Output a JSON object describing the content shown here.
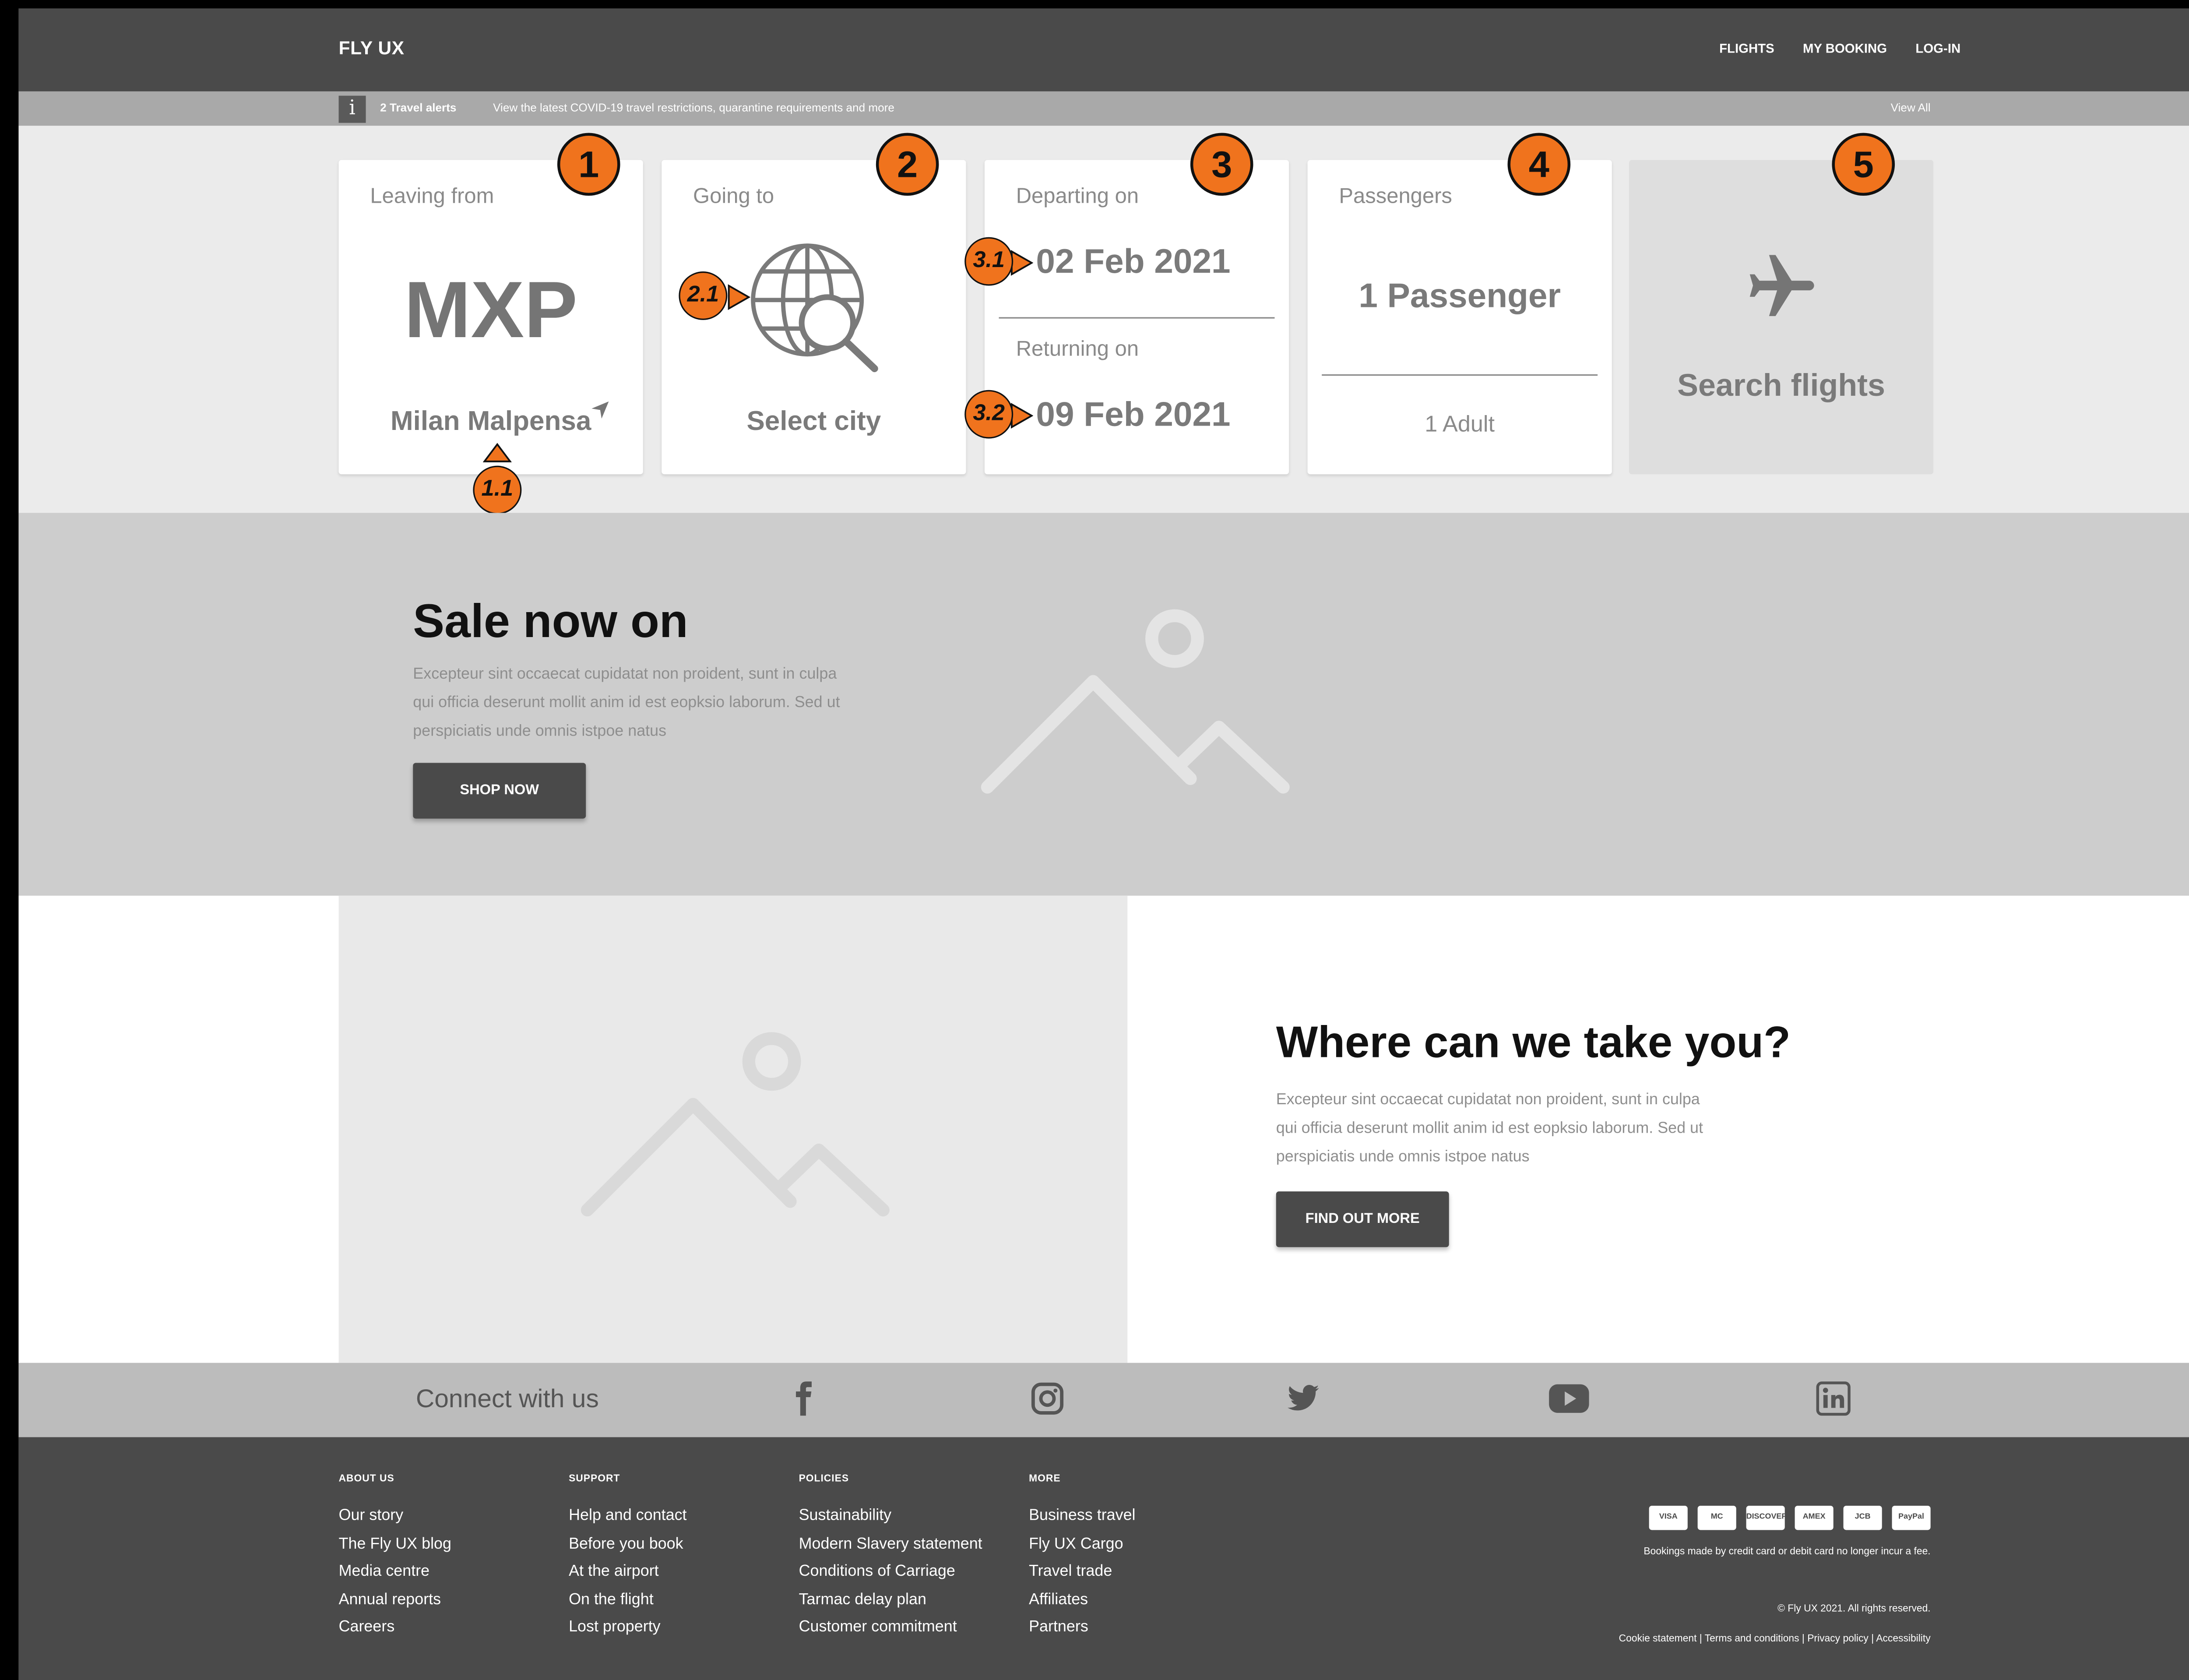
{
  "header": {
    "logo": "FLY UX",
    "nav": [
      "FLIGHTS",
      "MY BOOKING",
      "LOG-IN"
    ]
  },
  "alert": {
    "icon": "info-icon",
    "count_label": "2 Travel alerts",
    "message": "View the latest COVID-19 travel restrictions, quarantine requirements and more",
    "view_all": "View All"
  },
  "search": {
    "leaving": {
      "label": "Leaving from",
      "code": "MXP",
      "airport": "Milan Malpensa",
      "icon": "location-arrow-icon"
    },
    "going": {
      "label": "Going to",
      "placeholder": "Select city",
      "icon": "globe-search-icon"
    },
    "dates": {
      "depart_label": "Departing on",
      "depart": "02 Feb 2021",
      "return_label": "Returning on",
      "return": "09 Feb 2021"
    },
    "passengers": {
      "label": "Passengers",
      "value": "1 Passenger",
      "detail": "1 Adult"
    },
    "submit": {
      "label": "Search flights",
      "icon": "plane-icon"
    }
  },
  "annotations": {
    "badges": [
      "1",
      "2",
      "3",
      "4",
      "5"
    ],
    "sub": [
      "1.1",
      "2.1",
      "3.1",
      "3.2"
    ]
  },
  "hero": {
    "title": "Sale now on",
    "description": "Excepteur sint occaecat cupidatat non proident, sunt in culpa qui officia deserunt mollit anim id est eopksio laborum. Sed ut perspiciatis unde omnis istpoe natus",
    "button": "SHOP NOW"
  },
  "feature": {
    "title": "Where can we take you?",
    "description": "Excepteur sint occaecat cupidatat non proident, sunt in culpa qui officia deserunt mollit anim id est eopksio laborum. Sed ut perspiciatis unde omnis istpoe natus",
    "button": "FIND OUT MORE"
  },
  "connect": {
    "label": "Connect with us",
    "icons": [
      "facebook-icon",
      "instagram-icon",
      "twitter-icon",
      "youtube-icon",
      "linkedin-icon"
    ]
  },
  "footer": {
    "columns": [
      {
        "heading": "ABOUT US",
        "links": [
          "Our story",
          "The Fly UX blog",
          "Media centre",
          "Annual reports",
          "Careers"
        ]
      },
      {
        "heading": "SUPPORT",
        "links": [
          "Help and contact",
          "Before you book",
          "At the airport",
          "On the flight",
          "Lost property"
        ]
      },
      {
        "heading": "POLICIES",
        "links": [
          "Sustainability",
          "Modern Slavery statement",
          "Conditions of Carriage",
          "Tarmac delay plan",
          "Customer commitment"
        ]
      },
      {
        "heading": "MORE",
        "links": [
          "Business travel",
          "Fly UX Cargo",
          "Travel trade",
          "Affiliates",
          "Partners"
        ]
      }
    ],
    "payment_cards": [
      "VISA",
      "MC",
      "DISCOVER",
      "AMEX",
      "JCB",
      "PayPal"
    ],
    "payment_note": "Bookings made by credit card or debit card no longer incur a fee.",
    "copyright": "© Fly UX 2021. All rights reserved.",
    "legal_links": "Cookie statement | Terms and conditions | Privacy policy | Accessibility"
  },
  "colors": {
    "accent": "#f0731d",
    "dark": "#4a4a4a",
    "light": "#ebebeb"
  }
}
